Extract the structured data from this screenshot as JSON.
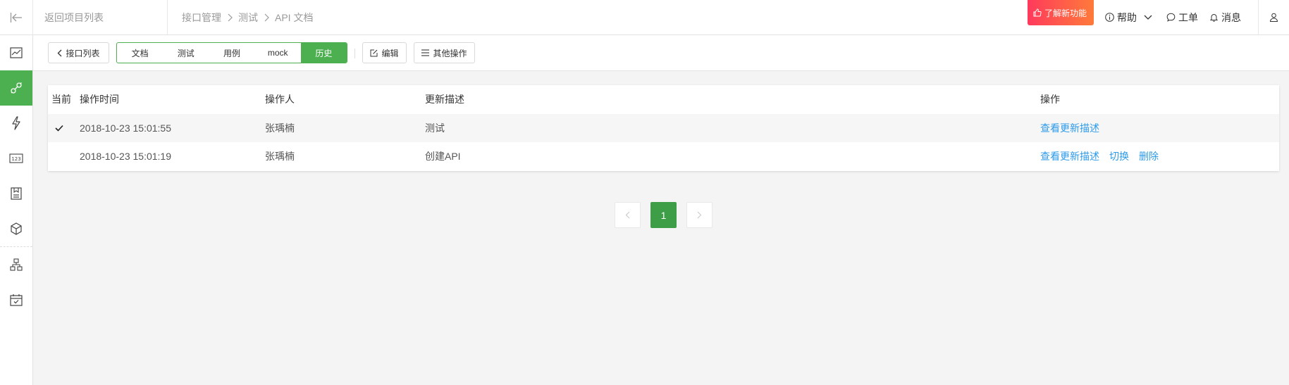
{
  "header": {
    "back_to_projects": "返回项目列表",
    "breadcrumb": [
      "接口管理",
      "测试",
      "API 文档"
    ],
    "new_feature": "了解新功能",
    "help": "帮助",
    "tickets": "工单",
    "messages": "消息"
  },
  "sidebar": {
    "items": [
      {
        "icon": "dashboard-icon",
        "active": false
      },
      {
        "icon": "api-icon",
        "active": true
      },
      {
        "icon": "lightning-icon",
        "active": false
      },
      {
        "icon": "numbers-icon",
        "active": false
      },
      {
        "icon": "document-icon",
        "active": false
      },
      {
        "icon": "cube-icon",
        "active": false
      },
      {
        "icon": "sitemap-icon",
        "active": false
      },
      {
        "icon": "calendar-check-icon",
        "active": false
      }
    ]
  },
  "toolbar": {
    "api_list": "接口列表",
    "tabs": [
      "文档",
      "测试",
      "用例",
      "mock",
      "历史"
    ],
    "active_tab": "历史",
    "edit": "编辑",
    "more_actions": "其他操作"
  },
  "table": {
    "columns": [
      "当前",
      "操作时间",
      "操作人",
      "更新描述",
      "操作"
    ],
    "rows": [
      {
        "current": true,
        "time": "2018-10-23 15:01:55",
        "user": "张瑀楠",
        "desc": "测试",
        "actions": [
          "查看更新描述"
        ]
      },
      {
        "current": false,
        "time": "2018-10-23 15:01:19",
        "user": "张瑀楠",
        "desc": "创建API",
        "actions": [
          "查看更新描述",
          "切换",
          "删除"
        ]
      }
    ]
  },
  "pagination": {
    "current": "1"
  },
  "colors": {
    "primary": "#4caf50",
    "link": "#2d9be8",
    "new_feature_gradient_start": "#ff3a5c",
    "new_feature_gradient_end": "#ff7a3a"
  }
}
